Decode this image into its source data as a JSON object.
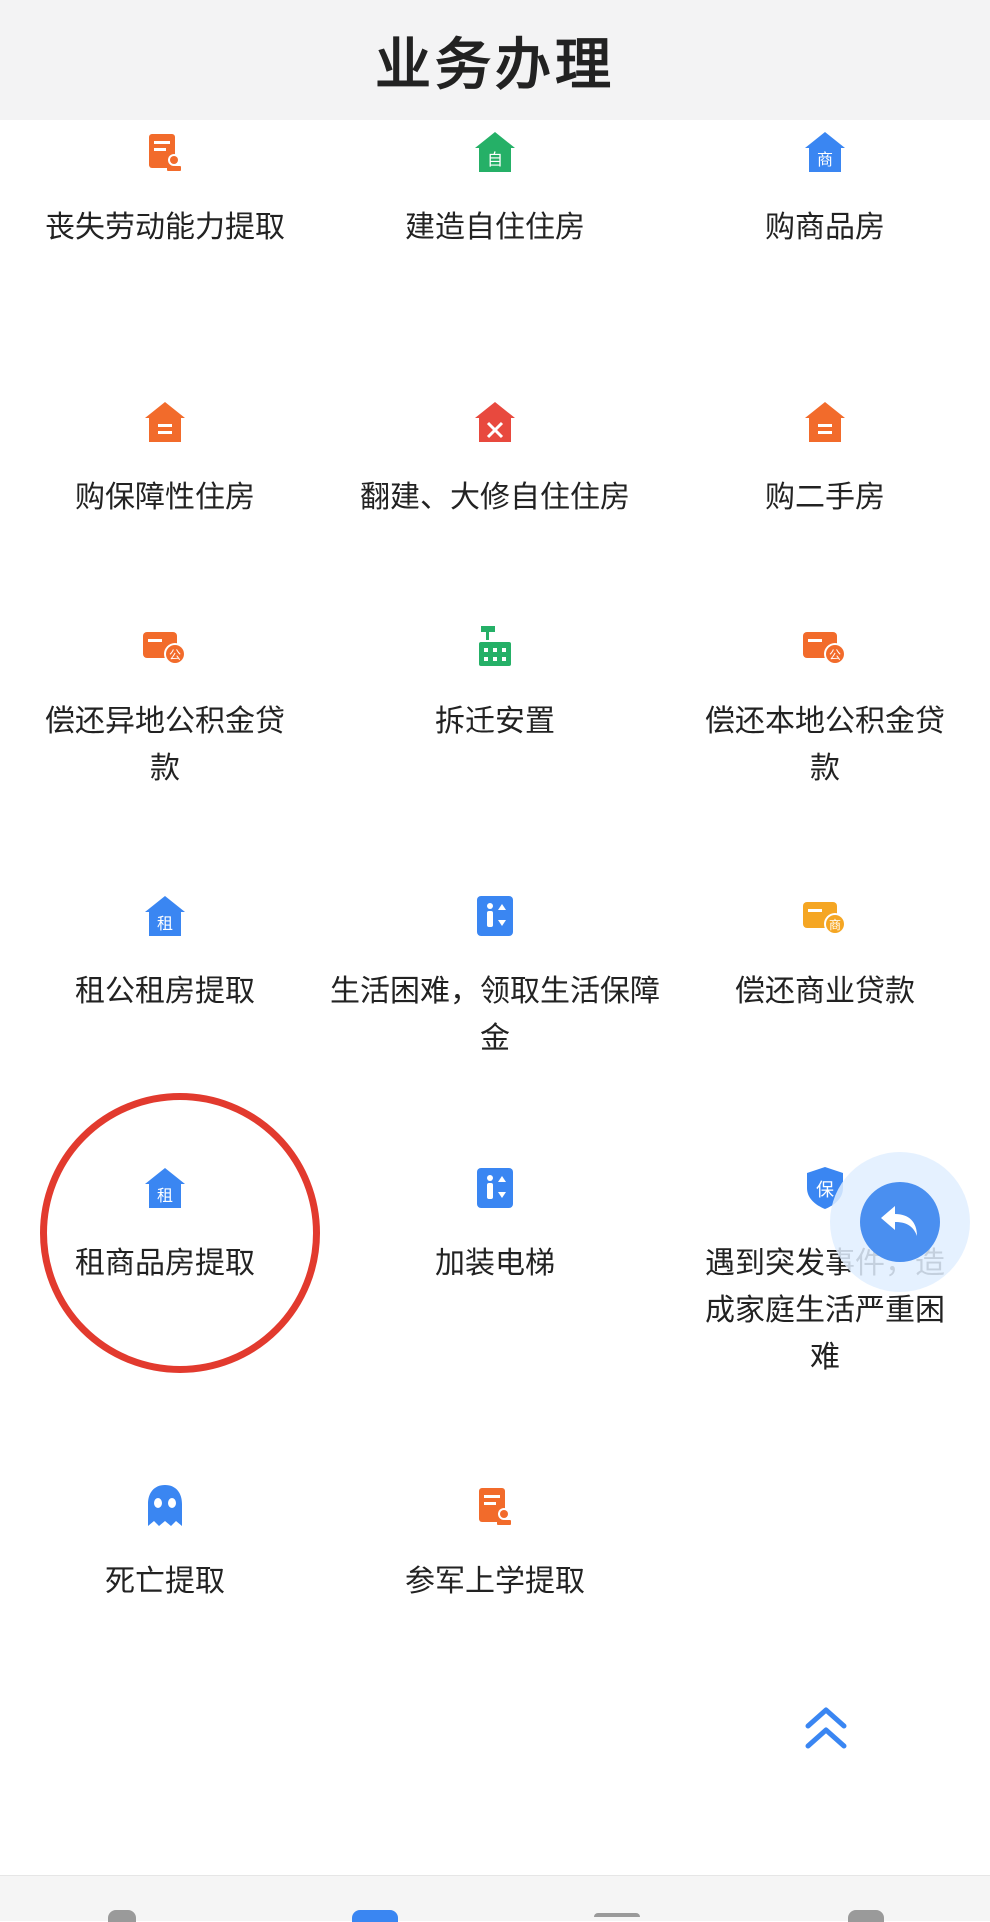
{
  "header": {
    "title": "业务办理"
  },
  "services": [
    {
      "label": "丧失劳动能力提取",
      "icon": "certificate-icon",
      "color": "#f26b2b"
    },
    {
      "label": "建造自住住房",
      "icon": "house-self-icon",
      "color": "#25b067",
      "glyph": "自"
    },
    {
      "label": "购商品房",
      "icon": "house-commercial-icon",
      "color": "#3a86f2",
      "glyph": "商"
    },
    {
      "label": "购保障性住房",
      "icon": "house-icon",
      "color": "#f26b2b"
    },
    {
      "label": "翻建、大修自住住房",
      "icon": "house-repair-icon",
      "color": "#e8493e"
    },
    {
      "label": "购二手房",
      "icon": "house-icon",
      "color": "#f26b2b"
    },
    {
      "label": "偿还异地公积金贷款",
      "icon": "card-fund-icon",
      "color": "#f26b2b",
      "glyph": "公"
    },
    {
      "label": "拆迁安置",
      "icon": "demolition-icon",
      "color": "#25b067"
    },
    {
      "label": "偿还本地公积金贷款",
      "icon": "card-fund-icon",
      "color": "#f26b2b",
      "glyph": "公"
    },
    {
      "label": "租公租房提取",
      "icon": "house-rent-icon",
      "color": "#3a86f2",
      "glyph": "租"
    },
    {
      "label": "生活困难，领取生活保障金",
      "icon": "elevator-icon",
      "color": "#3a86f2"
    },
    {
      "label": "偿还商业贷款",
      "icon": "card-commercial-icon",
      "color": "#f5a623",
      "glyph": "商"
    },
    {
      "label": "租商品房提取",
      "icon": "house-rent-icon",
      "color": "#3a86f2",
      "glyph": "租"
    },
    {
      "label": "加装电梯",
      "icon": "elevator-icon",
      "color": "#3a86f2"
    },
    {
      "label": "遇到突发事件，造成家庭生活严重困难",
      "icon": "shield-icon",
      "color": "#3a86f2",
      "glyph": "保"
    },
    {
      "label": "死亡提取",
      "icon": "ghost-icon",
      "color": "#3a86f2"
    },
    {
      "label": "参军上学提取",
      "icon": "certificate-icon",
      "color": "#f26b2b"
    }
  ],
  "colors": {
    "accent": "#4a8ff0",
    "highlight_circle": "#e23a2e",
    "header_bg": "#f3f3f4"
  }
}
